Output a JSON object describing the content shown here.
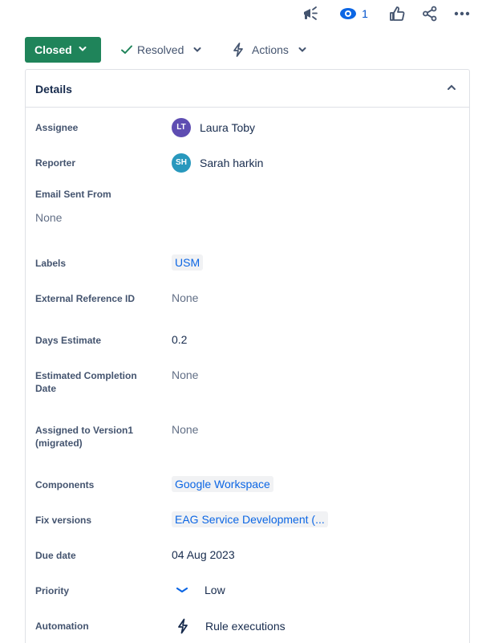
{
  "toolbar": {
    "watchers_count": "1"
  },
  "status": {
    "current": "Closed",
    "resolution": "Resolved",
    "actions": "Actions"
  },
  "details": {
    "title": "Details",
    "assignee": {
      "label": "Assignee",
      "initials": "LT",
      "name": "Laura Toby",
      "avatar_color": "#5e4db2"
    },
    "reporter": {
      "label": "Reporter",
      "initials": "SH",
      "name": "Sarah harkin",
      "avatar_color": "#2898bd"
    },
    "email_sent_from": {
      "label": "Email Sent From",
      "value": "None"
    },
    "labels": {
      "label": "Labels",
      "value": "USM"
    },
    "external_reference_id": {
      "label": "External Reference ID",
      "value": "None"
    },
    "days_estimate": {
      "label": "Days Estimate",
      "value": "0.2"
    },
    "estimated_completion_date": {
      "label_line1": "Estimated Completion",
      "label_line2": "Date",
      "value": "None"
    },
    "assigned_to_version": {
      "label_line1": "Assigned to Version1",
      "label_line2": "(migrated)",
      "value": "None"
    },
    "components": {
      "label": "Components",
      "value": "Google Workspace"
    },
    "fix_versions": {
      "label": "Fix versions",
      "value": "EAG Service Development (..."
    },
    "due_date": {
      "label": "Due date",
      "value": "04 Aug 2023"
    },
    "priority": {
      "label": "Priority",
      "value": "Low",
      "icon": "priority-low-icon",
      "icon_color": "#0c66e4"
    },
    "automation": {
      "label": "Automation",
      "value": "Rule executions",
      "icon": "lightning-icon"
    }
  },
  "colors": {
    "status_green": "#1f845a",
    "link_blue": "#0c66e4",
    "text_primary": "#172b4d",
    "text_subtle": "#44546f"
  }
}
